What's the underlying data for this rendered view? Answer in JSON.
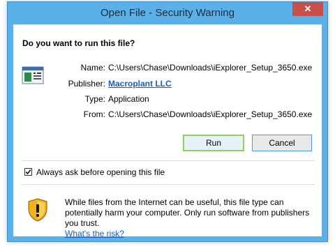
{
  "window": {
    "title": "Open File - Security Warning",
    "close_glyph": "✕"
  },
  "dialog": {
    "question": "Do you want to run this file?",
    "file_icon": "application-file-icon",
    "fields": {
      "name_label": "Name:",
      "name_value": "C:\\Users\\Chase\\Downloads\\iExplorer_Setup_3650.exe",
      "publisher_label": "Publisher:",
      "publisher_value": "Macroplant LLC",
      "type_label": "Type:",
      "type_value": "Application",
      "from_label": "From:",
      "from_value": "C:\\Users\\Chase\\Downloads\\iExplorer_Setup_3650.exe"
    },
    "buttons": {
      "run_label": "Run",
      "cancel_label": "Cancel"
    },
    "always_ask": {
      "label": "Always ask before opening this file",
      "checked": true
    },
    "warning": {
      "icon": "security-shield-warning-icon",
      "text": "While files from the Internet can be useful, this file type can potentially harm your computer. Only run software from publishers you trust.",
      "link_text": "What's the risk?"
    }
  },
  "colors": {
    "frame": "#5cb0e8",
    "close_button": "#c7504b",
    "link": "#1a5fb4",
    "run_focus_border": "#94d155"
  }
}
